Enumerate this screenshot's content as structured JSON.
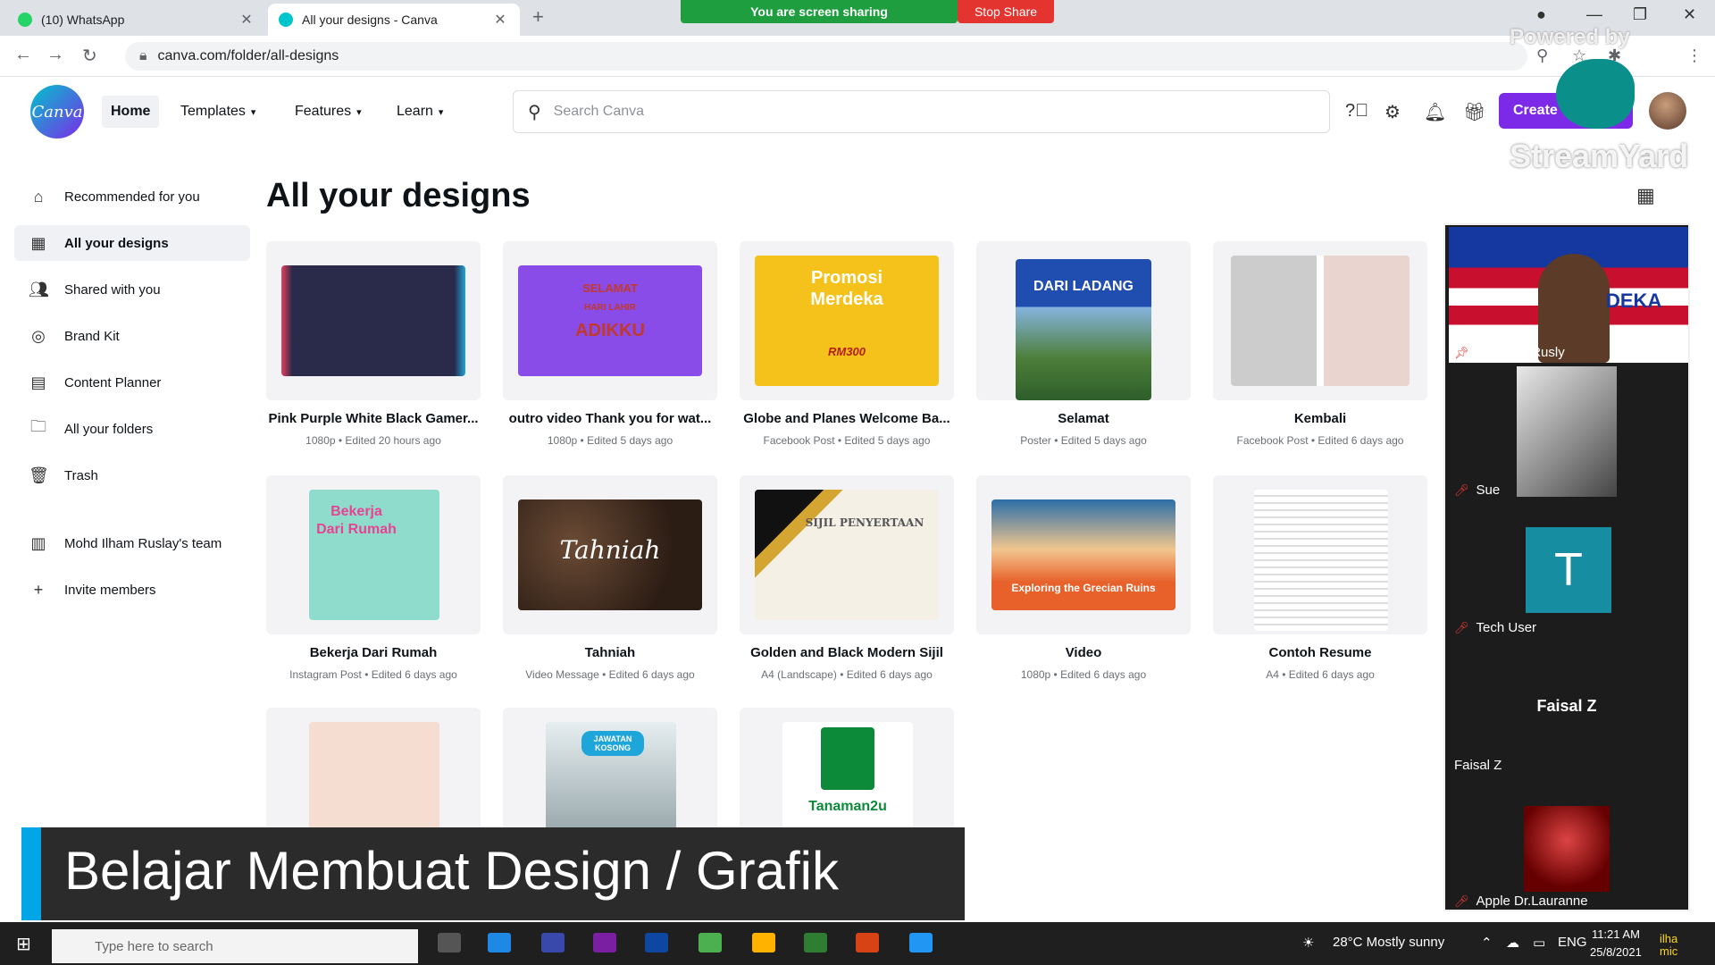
{
  "browser": {
    "tabs": [
      {
        "title": "(10) WhatsApp",
        "active": false,
        "favicon_color": "#25d366"
      },
      {
        "title": "All your designs - Canva",
        "active": true,
        "favicon_color": "#00c4cc"
      }
    ],
    "new_tab": "+",
    "url": "canva.com/folder/all-designs",
    "screen_share_text": "You are screen sharing",
    "stop_share": "Stop Share"
  },
  "header": {
    "logo": "Canva",
    "nav": [
      "Home",
      "Templates",
      "Features",
      "Learn"
    ],
    "search_placeholder": "Search Canva",
    "create_label": "Create"
  },
  "sidebar": {
    "items": [
      {
        "label": "Recommended for you",
        "icon": "home-icon"
      },
      {
        "label": "All your designs",
        "icon": "grid-icon",
        "active": true
      },
      {
        "label": "Shared with you",
        "icon": "people-icon"
      },
      {
        "label": "Brand Kit",
        "icon": "brand-icon"
      },
      {
        "label": "Content Planner",
        "icon": "calendar-icon"
      },
      {
        "label": "All your folders",
        "icon": "folder-icon"
      },
      {
        "label": "Trash",
        "icon": "trash-icon"
      },
      {
        "label": "Mohd Ilham Ruslay's team",
        "icon": "team-icon"
      },
      {
        "label": "Invite members",
        "icon": "plus-icon"
      }
    ]
  },
  "main": {
    "title": "All your designs",
    "designs": [
      {
        "name": "Pink Purple White Black Gamer...",
        "meta": "1080p • Edited 20 hours ago",
        "color": "#2a2a4a"
      },
      {
        "name": "outro video Thank you for wat...",
        "meta": "1080p • Edited 5 days ago",
        "color": "#8a4ce8",
        "thumb_lines": [
          "SELAMAT",
          "HARI LAHIR",
          "ADIKKU"
        ]
      },
      {
        "name": "Globe and Planes Welcome Ba...",
        "meta": "Facebook Post • Edited 5 days ago",
        "color": "#f5c21b",
        "thumb_lines": [
          "Promosi",
          "Merdeka",
          "RM300"
        ]
      },
      {
        "name": "Selamat",
        "meta": "Poster • Edited 5 days ago",
        "color": "#1f4db0",
        "thumb_lines": [
          "DARI LADANG"
        ]
      },
      {
        "name": "Kembali",
        "meta": "Facebook Post • Edited 6 days ago",
        "color": "#d9c9c4"
      },
      {
        "name": "Bekerja Dari Rumah",
        "meta": "Instagram Post • Edited 6 days ago",
        "color": "#8fdccd",
        "thumb_lines": [
          "Bekerja",
          "Dari Rumah"
        ]
      },
      {
        "name": "Tahniah",
        "meta": "Video Message • Edited 6 days ago",
        "color": "#3a2a20",
        "thumb_lines": [
          "Tahniah"
        ]
      },
      {
        "name": "Golden and Black Modern Sijil",
        "meta": "A4 (Landscape) • Edited 6 days ago",
        "color": "#f4f0e6",
        "thumb_lines": [
          "SIJIL PENYERTAAN"
        ]
      },
      {
        "name": "Video",
        "meta": "1080p • Edited 6 days ago",
        "color": "#e8602a",
        "thumb_lines": [
          "Exploring the Grecian Ruins"
        ]
      },
      {
        "name": "Contoh Resume",
        "meta": "A4 • Edited 6 days ago",
        "color": "#ededed"
      },
      {
        "name": "",
        "meta": "",
        "color": "#f5ddd2"
      },
      {
        "name": "",
        "meta": "",
        "color": "#c9d3d6",
        "thumb_lines": [
          "JAWATAN",
          "KOSONG"
        ]
      },
      {
        "name": "",
        "meta": "",
        "color": "#ffffff",
        "thumb_lines": [
          "Tanaman2u"
        ]
      }
    ]
  },
  "streamyard": {
    "powered_by": "Powered by",
    "brand": "StreamYard",
    "participants": [
      "M. Ilham Rusly",
      "Sue",
      "Tech User",
      "Faisal Z",
      "Apple Dr.Lauranne"
    ],
    "featured_name": "Faisal Z",
    "overlay_text": "DEKA",
    "tile_initial": "T"
  },
  "lower_third": {
    "text": "Belajar Membuat Design / Grafik"
  },
  "taskbar": {
    "search_placeholder": "Type here to search",
    "weather": "28°C  Mostly sunny",
    "lang": "ENG",
    "time": "11:21 AM",
    "date": "25/8/2021",
    "corner_label": "ilha mic"
  }
}
